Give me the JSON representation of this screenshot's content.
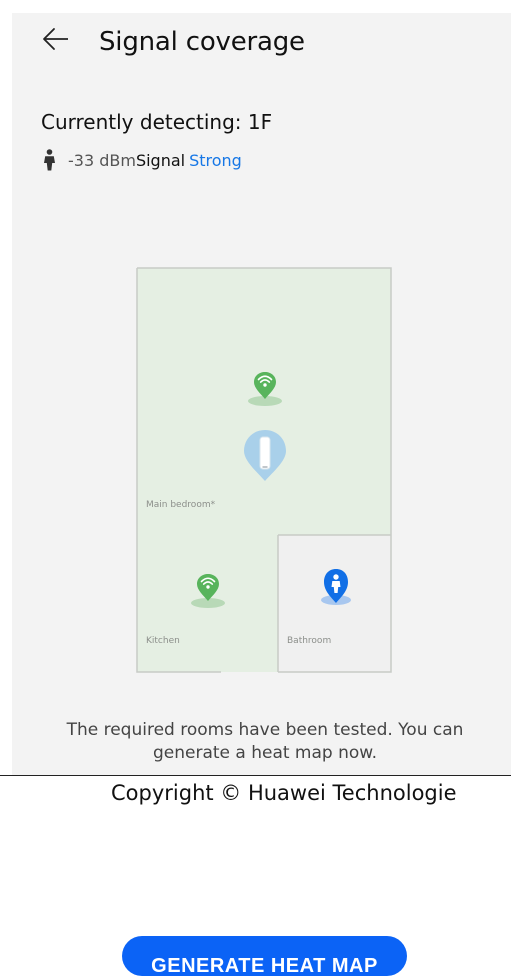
{
  "header": {
    "title": "Signal coverage",
    "back_icon": "back-arrow-icon"
  },
  "detection": {
    "title": "Currently detecting: 1F",
    "dbm": "-33 dBm",
    "signal_label": "Signal",
    "signal_value": "Strong"
  },
  "map": {
    "rooms": [
      {
        "label": "Main bedroom*"
      },
      {
        "label": "Kitchen"
      },
      {
        "label": "Bathroom"
      }
    ],
    "markers": {
      "wifi_icon": "wifi-location-icon",
      "router_icon": "router-location-icon",
      "person_icon": "person-location-icon"
    }
  },
  "message": "The required rooms have been tested. You can generate a heat map now.",
  "copyright": "Copyright © Huawei Technologie",
  "actions": {
    "generate_label": "GENERATE HEAT MAP"
  },
  "colors": {
    "accent": "#0b63f6",
    "signal_strong": "#1677e6",
    "wifi_marker": "#58b45c",
    "router_marker": "#a9d0ea",
    "floor_fill": "#e5efe3",
    "bathroom_fill": "#f0f0f0"
  }
}
